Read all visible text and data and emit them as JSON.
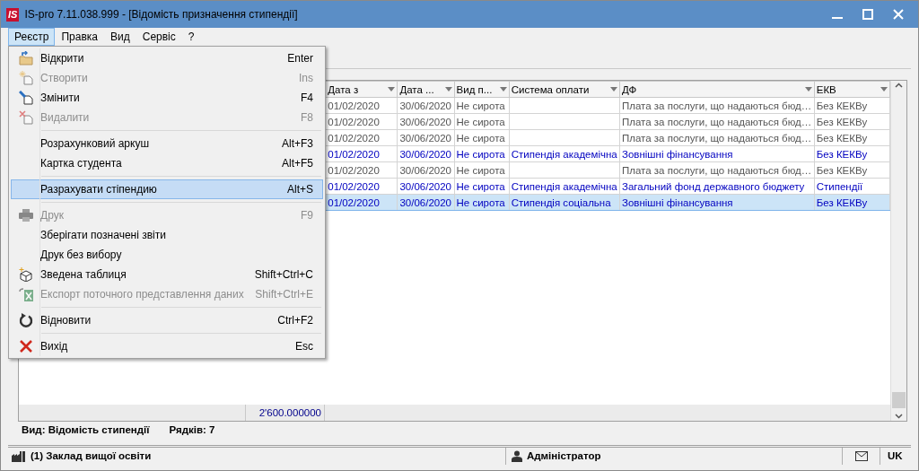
{
  "window": {
    "logo": "IS",
    "title": "IS-pro 7.11.038.999 - [Відомість призначення стипендії]"
  },
  "menubar": [
    {
      "label": "Реєстр",
      "selected": true
    },
    {
      "label": "Правка",
      "selected": false
    },
    {
      "label": "Вид",
      "selected": false
    },
    {
      "label": "Сервіс",
      "selected": false
    },
    {
      "label": "?",
      "selected": false
    }
  ],
  "menu": [
    {
      "kind": "item",
      "label": "Відкрити",
      "shortcut": "Enter",
      "disabled": false,
      "selected": false
    },
    {
      "kind": "item",
      "label": "Створити",
      "shortcut": "Ins",
      "disabled": true,
      "selected": false
    },
    {
      "kind": "item",
      "label": "Змінити",
      "shortcut": "F4",
      "disabled": false,
      "selected": false
    },
    {
      "kind": "item",
      "label": "Видалити",
      "shortcut": "F8",
      "disabled": true,
      "selected": false
    },
    {
      "kind": "separator"
    },
    {
      "kind": "item",
      "label": "Розрахунковий аркуш",
      "shortcut": "Alt+F3",
      "disabled": false,
      "selected": false
    },
    {
      "kind": "item",
      "label": "Картка студента",
      "shortcut": "Alt+F5",
      "disabled": false,
      "selected": false
    },
    {
      "kind": "separator"
    },
    {
      "kind": "item",
      "label": "Разрахувати стіпендию",
      "shortcut": "Alt+S",
      "disabled": false,
      "selected": true
    },
    {
      "kind": "separator"
    },
    {
      "kind": "item",
      "label": "Друк",
      "shortcut": "F9",
      "disabled": true,
      "selected": false
    },
    {
      "kind": "item",
      "label": "Зберігати позначені звіти",
      "disabled": false,
      "selected": false
    },
    {
      "kind": "item",
      "label": "Друк без вибору",
      "disabled": false,
      "selected": false
    },
    {
      "kind": "item",
      "label": "Зведена таблиця",
      "shortcut": "Shift+Ctrl+C",
      "disabled": false,
      "selected": false
    },
    {
      "kind": "item",
      "label": "Експорт поточного представлення даних",
      "shortcut": "Shift+Ctrl+E",
      "disabled": true,
      "selected": false
    },
    {
      "kind": "separator"
    },
    {
      "kind": "item",
      "label": "Відновити",
      "shortcut": "Ctrl+F2",
      "disabled": false,
      "selected": false
    },
    {
      "kind": "separator"
    },
    {
      "kind": "item",
      "label": "Вихід",
      "shortcut": "Esc",
      "disabled": false,
      "selected": false
    }
  ],
  "table": {
    "columns": [
      "Дата з",
      "Дата ...",
      "Вид п...",
      "Система оплати",
      "ДФ",
      "ЕКВ"
    ],
    "rows": [
      {
        "color": "#555555",
        "selected": false,
        "cells": [
          "01/02/2020",
          "30/06/2020",
          "Не сирота",
          "",
          "Плата за послуги, що надаються бюд…",
          "Без КЕКВу"
        ]
      },
      {
        "color": "#555555",
        "selected": false,
        "cells": [
          "01/02/2020",
          "30/06/2020",
          "Не сирота",
          "",
          "Плата за послуги, що надаються бюд…",
          "Без КЕКВу"
        ]
      },
      {
        "color": "#555555",
        "selected": false,
        "cells": [
          "01/02/2020",
          "30/06/2020",
          "Не сирота",
          "",
          "Плата за послуги, що надаються бюд…",
          "Без КЕКВу"
        ]
      },
      {
        "color": "#0000c0",
        "selected": false,
        "cells": [
          "01/02/2020",
          "30/06/2020",
          "Не сирота",
          "Стипендія академічна",
          "Зовнішні фінансування",
          "Без КЕКВу"
        ]
      },
      {
        "color": "#555555",
        "selected": false,
        "cells": [
          "01/02/2020",
          "30/06/2020",
          "Не сирота",
          "",
          "Плата за послуги, що надаються бюд…",
          "Без КЕКВу"
        ]
      },
      {
        "color": "#0000c0",
        "selected": false,
        "cells": [
          "01/02/2020",
          "30/06/2020",
          "Не сирота",
          "Стипендія академічна",
          "Загальний фонд державного бюджету",
          "Стипендії"
        ]
      },
      {
        "color": "#0000c0",
        "selected": true,
        "cells": [
          "01/02/2020",
          "30/06/2020",
          "Не сирота",
          "Стипендія соціальна",
          "Зовнішні фінансування",
          "Без КЕКВу"
        ]
      }
    ],
    "total": "2'600.000000"
  },
  "info": {
    "view": "Вид: Відомість стипендії",
    "rows": "Рядків: 7"
  },
  "status_bar": {
    "organization": "(1) Заклад вищої освіти",
    "user": "Адміністратор",
    "language": "UK"
  }
}
